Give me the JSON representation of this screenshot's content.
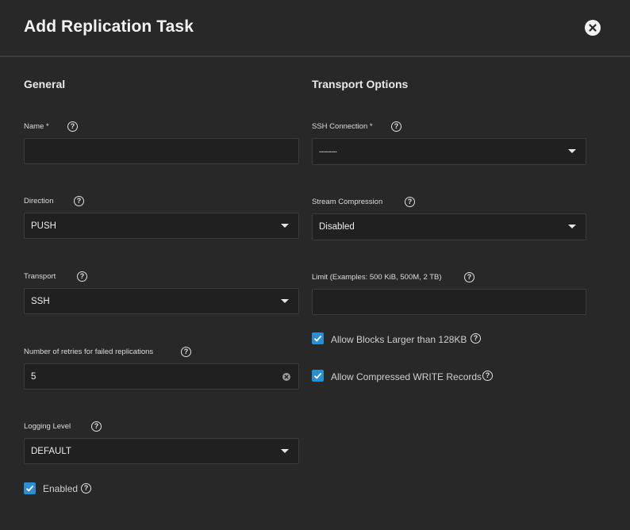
{
  "dialog": {
    "title": "Add Replication Task",
    "close_icon": "close-icon"
  },
  "general": {
    "section_title": "General",
    "name": {
      "label": "Name *",
      "value": ""
    },
    "direction": {
      "label": "Direction",
      "value": "PUSH"
    },
    "transport": {
      "label": "Transport",
      "value": "SSH"
    },
    "retries": {
      "label": "Number of retries for failed replications",
      "value": "5"
    },
    "logging_level": {
      "label": "Logging Level",
      "value": "DEFAULT"
    },
    "enabled": {
      "label": "Enabled",
      "checked": true
    }
  },
  "transport_options": {
    "section_title": "Transport Options",
    "ssh_connection": {
      "label": "SSH Connection *",
      "value": "---------"
    },
    "stream_compression": {
      "label": "Stream Compression",
      "value": "Disabled"
    },
    "limit": {
      "label": "Limit (Examples: 500 KiB, 500M, 2 TB)",
      "value": ""
    },
    "large_blocks": {
      "label": "Allow Blocks Larger than 128KB",
      "checked": true
    },
    "compressed_write": {
      "label": "Allow Compressed WRITE Records",
      "checked": true
    }
  },
  "icons": {
    "help": "?",
    "help_icon": "help-circle-icon",
    "dropdown_icon": "chevron-down-icon",
    "check_icon": "checkmark-icon"
  },
  "colors": {
    "background": "#282828",
    "field": "#202020",
    "checkbox": "#2a8fd0"
  }
}
